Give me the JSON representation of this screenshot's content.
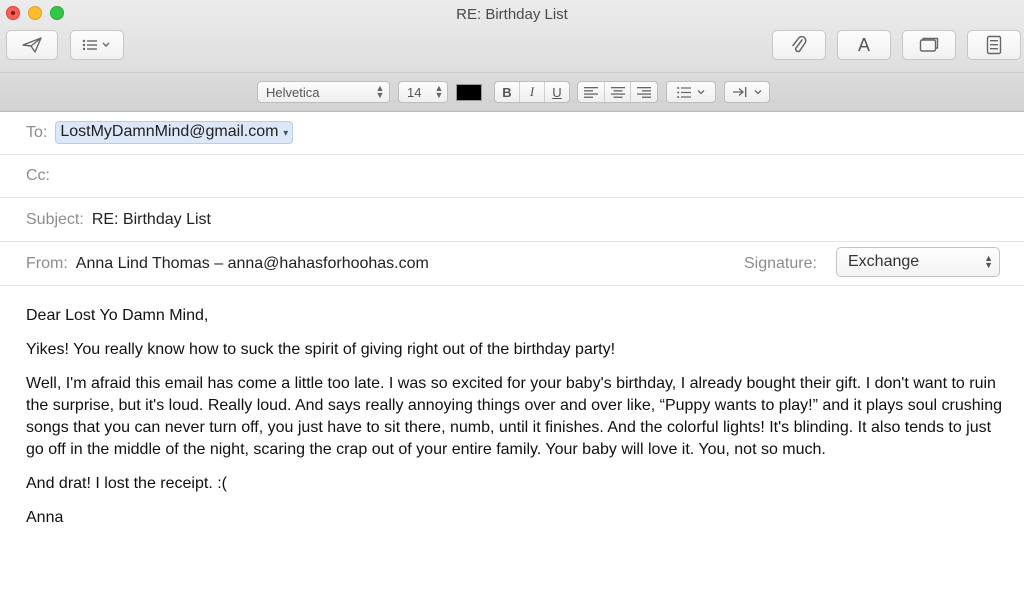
{
  "window": {
    "title": "RE: Birthday List"
  },
  "toolbar": {
    "send_icon": "paper-plane-icon",
    "header_fields_icon": "list-dropdown-icon",
    "attach_icon": "paperclip-icon",
    "fonts_label": "A",
    "photo_browser_icon": "photo-browser-icon",
    "format_panel_icon": "format-panel-icon"
  },
  "format_bar": {
    "font_family": "Helvetica",
    "font_size": "14",
    "text_color": "#000000",
    "bold": "B",
    "italic": "I",
    "underline": "U",
    "alignment_icons": [
      "align-left-icon",
      "align-center-icon",
      "align-right-icon"
    ],
    "list_icon": "bullet-list-icon",
    "indent_icon": "indent-icon"
  },
  "header": {
    "to_label": "To:",
    "to_value": "LostMyDamnMind@gmail.com",
    "cc_label": "Cc:",
    "cc_value": "",
    "subject_label": "Subject:",
    "subject_value": "RE: Birthday List",
    "from_label": "From:",
    "from_value": "Anna Lind Thomas – anna@hahasforhoohas.com",
    "signature_label": "Signature:",
    "signature_value": "Exchange"
  },
  "body": {
    "paragraphs": [
      "Dear Lost Yo Damn Mind,",
      "Yikes! You really know how to suck the spirit of giving right out of the birthday party!",
      "Well, I'm afraid this email has come a little too late. I was so excited for your baby's birthday, I already bought their gift. I don't want to ruin the surprise, but it's loud. Really loud. And says really annoying things over and over like, “Puppy wants to play!” and it plays soul crushing songs that you can never turn off, you just have to sit there, numb, until it finishes. And the colorful lights! It's blinding. It also tends to just go off in the middle of the night, scaring the crap out of your entire family. Your baby will love it. You, not so much.",
      "And drat! I lost the receipt. :(",
      "Anna"
    ]
  },
  "colors": {
    "close": "#fc5f57",
    "minimize": "#fdbc2e",
    "zoom": "#33c748",
    "token_background": "#dce8f8"
  }
}
